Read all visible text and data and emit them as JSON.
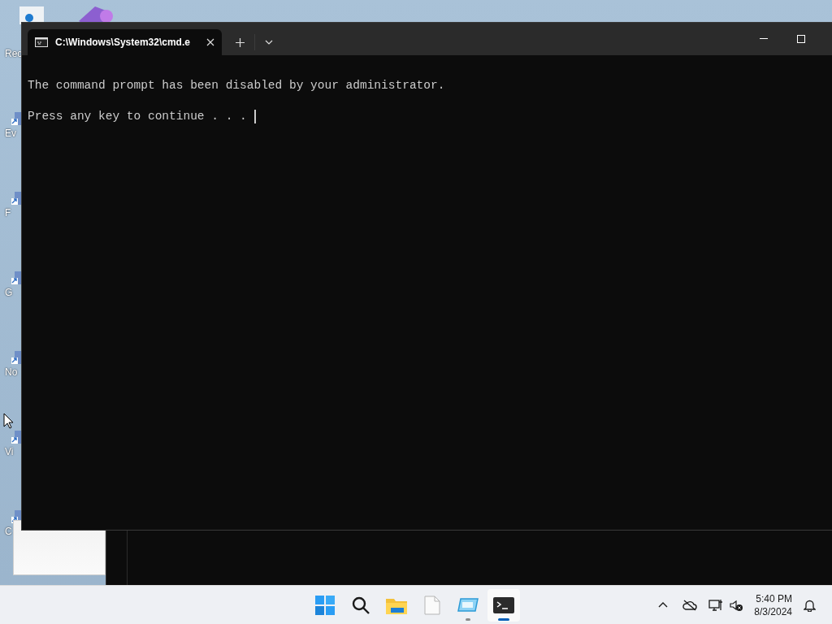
{
  "desktop": {
    "icons": [
      {
        "label": "Rec"
      },
      {
        "label": "Ev"
      },
      {
        "label": "F"
      },
      {
        "label": "G"
      },
      {
        "label": "No"
      },
      {
        "label": "Vi"
      },
      {
        "label": "C"
      }
    ]
  },
  "terminal": {
    "tabs": [
      {
        "title": "C:\\Windows\\System32\\cmd.e",
        "selected": true
      }
    ],
    "lines": [
      "The command prompt has been disabled by your administrator.",
      "Press any key to continue . . ."
    ]
  },
  "taskbar": {
    "apps": [
      {
        "kind": "start",
        "running": false,
        "selected": false
      },
      {
        "kind": "search",
        "running": false,
        "selected": false
      },
      {
        "kind": "folder",
        "running": false,
        "selected": false
      },
      {
        "kind": "file",
        "running": false,
        "selected": false
      },
      {
        "kind": "app",
        "running": true,
        "selected": false
      },
      {
        "kind": "terminal",
        "running": true,
        "selected": true
      }
    ],
    "clock": {
      "time": "5:40 PM",
      "date": "8/3/2024"
    }
  }
}
